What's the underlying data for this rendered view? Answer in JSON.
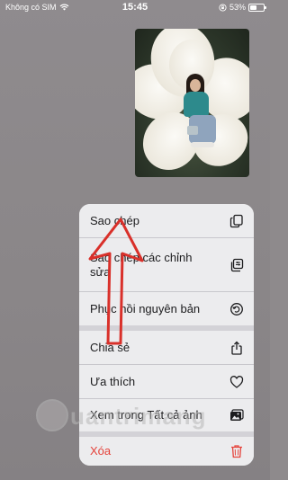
{
  "status": {
    "carrier": "Không có SIM",
    "time": "15:45",
    "battery_percent": "53%",
    "battery_level": 0.53
  },
  "menu": {
    "items": [
      {
        "label": "Sao chép",
        "icon": "copy-icon"
      },
      {
        "label": "Sao chép các chỉnh sửa",
        "icon": "copy-edits-icon"
      },
      {
        "label": "Phục hồi nguyên bản",
        "icon": "revert-icon"
      },
      {
        "label": "Chia sẻ",
        "icon": "share-icon"
      },
      {
        "label": "Ưa thích",
        "icon": "heart-icon"
      },
      {
        "label": "Xem trong Tất cả ảnh",
        "icon": "photos-icon"
      },
      {
        "label": "Xóa",
        "icon": "trash-icon",
        "color": "#e5433b"
      }
    ]
  },
  "watermark": {
    "text": "uantrimang"
  },
  "colors": {
    "danger": "#e5433b",
    "arrow": "#d9302a",
    "menu_bg": "#ececee"
  }
}
